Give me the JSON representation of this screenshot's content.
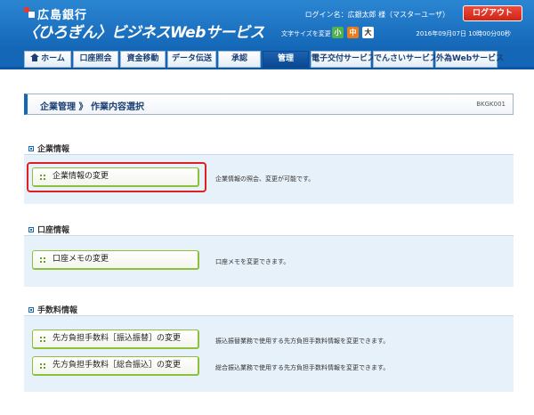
{
  "header": {
    "bank_name": "広島銀行",
    "service_name": "〈ひろぎん〉ビジネスWebサービス",
    "login_name": "ログイン名：広銀太郎 様（マスターユーザ）",
    "logout_label": "ログアウト",
    "fontsize_label": "文字サイズを変更",
    "fontsize_small": "小",
    "fontsize_mid": "中",
    "fontsize_large": "大",
    "datetime": "2016年09月07日 10時00分00秒"
  },
  "nav": {
    "tabs": [
      {
        "label": "ホーム"
      },
      {
        "label": "口座照会"
      },
      {
        "label": "資金移動"
      },
      {
        "label": "データ伝送"
      },
      {
        "label": "承認"
      },
      {
        "label": "管理"
      },
      {
        "label": "電子交付サービス"
      },
      {
        "label": "でんさいサービス"
      },
      {
        "label": "外為Webサービス"
      }
    ],
    "active_tab": "管理"
  },
  "page": {
    "title": "企業管理 》 作業内容選択",
    "screen_id": "BKGK001"
  },
  "sections": [
    {
      "title": "企業情報",
      "items": [
        {
          "button": "企業情報の変更",
          "desc": "企業情報の照会、変更が可能です。"
        }
      ]
    },
    {
      "title": "口座情報",
      "items": [
        {
          "button": "口座メモの変更",
          "desc": "口座メモを変更できます。"
        }
      ]
    },
    {
      "title": "手数料情報",
      "items": [
        {
          "button": "先方負担手数料［振込振替］の変更",
          "desc": "振込振替業務で使用する先方負担手数料情報を変更できます。"
        },
        {
          "button": "先方負担手数料［総合振込］の変更",
          "desc": "総合振込業務で使用する先方負担手数料情報を変更できます。"
        }
      ]
    }
  ],
  "colors": {
    "header_blue": "#1467b7",
    "highlight_red": "#e02020",
    "button_border_green": "#8dc13b",
    "section_bg": "#e7f1fa"
  }
}
